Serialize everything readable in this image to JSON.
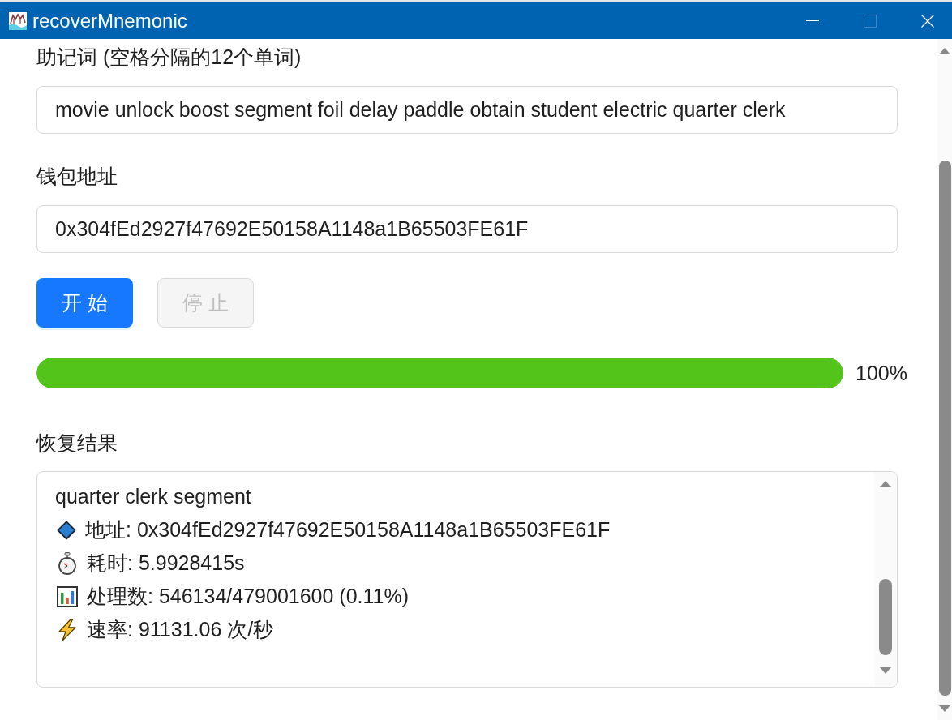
{
  "window": {
    "title": "recoverMnemonic",
    "controls": [
      {
        "kind": "minimize",
        "disabled": false
      },
      {
        "kind": "maximize",
        "disabled": true
      },
      {
        "kind": "close",
        "disabled": false
      }
    ]
  },
  "mnemonic": {
    "label": "助记词 (空格分隔的12个单词)",
    "value": "movie unlock boost segment foil delay paddle obtain student electric quarter clerk"
  },
  "wallet_address": {
    "label": "钱包地址",
    "value": "0x304fEd2927f47692E50158A1148a1B65503FE61F"
  },
  "buttons": [
    {
      "label": "开 始",
      "kind": "primary",
      "disabled": false
    },
    {
      "label": "停 止",
      "kind": "default",
      "disabled": true
    }
  ],
  "progress": {
    "level": 1,
    "reading": "100%"
  },
  "results": {
    "label": "恢复结果",
    "lines": [
      {
        "kind": "text",
        "text": "quarter clerk segment"
      },
      {
        "kind": "address",
        "text": "地址: 0x304fEd2927f47692E50158A1148a1B65503FE61F"
      },
      {
        "kind": "time",
        "text": "耗时: 5.9928415s"
      },
      {
        "kind": "count",
        "text": "处理数: 546134/479001600 (0.11%)"
      },
      {
        "kind": "rate",
        "text": "速率: 91131.06 次/秒"
      }
    ]
  }
}
